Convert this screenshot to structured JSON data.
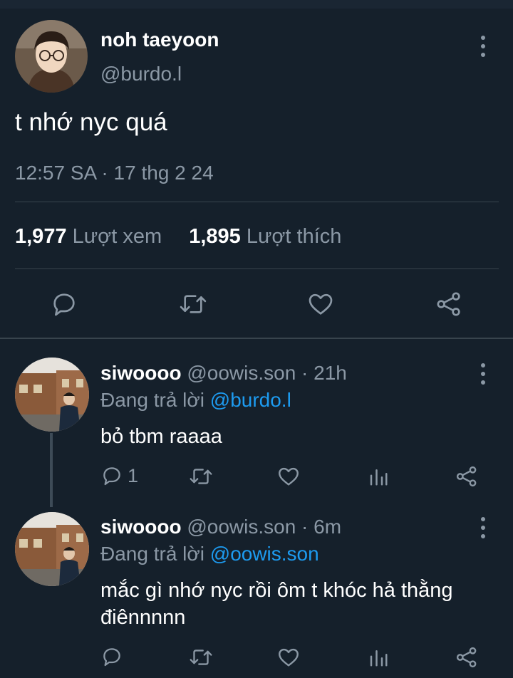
{
  "main": {
    "name": "noh taeyoon",
    "handle": "@burdo.l",
    "text": "t nhớ nyc quá",
    "time": "12:57 SA · 17 thg 2 24",
    "views_count": "1,977",
    "views_label": "Lượt xem",
    "likes_count": "1,895",
    "likes_label": "Lượt thích"
  },
  "replies": [
    {
      "name": "siwoooo",
      "meta": "@oowis.son · 21h",
      "replying_prefix": "Đang trả lời",
      "replying_to": "@burdo.l",
      "text": "bỏ tbm raaaa",
      "reply_count": "1"
    },
    {
      "name": "siwoooo",
      "meta": "@oowis.son · 6m",
      "replying_prefix": "Đang trả lời",
      "replying_to": "@oowis.son",
      "text": "mắc gì nhớ nyc rồi ôm t khóc hả thằng điênnnnn",
      "reply_count": ""
    }
  ],
  "icons": [
    "reply-icon",
    "retweet-icon",
    "like-icon",
    "share-icon",
    "analytics-icon",
    "more-icon"
  ],
  "colors": {
    "background": "#15202b",
    "secondary_text": "#8b98a5",
    "link": "#1d9bf0",
    "divider": "#38444d"
  }
}
